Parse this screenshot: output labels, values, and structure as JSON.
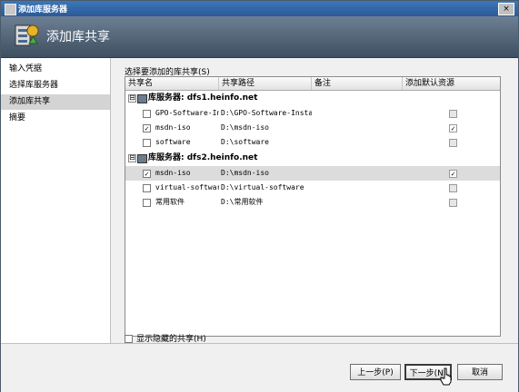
{
  "window": {
    "title": "添加库服务器",
    "close_glyph": "×"
  },
  "header": {
    "title": "添加库共享"
  },
  "nav": [
    {
      "label": "输入凭据",
      "selected": false
    },
    {
      "label": "选择库服务器",
      "selected": false
    },
    {
      "label": "添加库共享",
      "selected": true
    },
    {
      "label": "摘要",
      "selected": false
    }
  ],
  "content": {
    "section_label": "选择要添加的库共享(S)",
    "columns": [
      "共享名",
      "共享路径",
      "备注",
      "添加默认资源"
    ],
    "groups": [
      {
        "expander": "⊟",
        "label": "库服务器: dfs1.heinfo.net",
        "rows": [
          {
            "checked": false,
            "name": "GPO-Software-Ins",
            "path": "D:\\GPO-Software-Install",
            "default_checked": false
          },
          {
            "checked": true,
            "name": "msdn-iso",
            "path": "D:\\msdn-iso",
            "default_checked": true
          },
          {
            "checked": false,
            "name": "software",
            "path": "D:\\software",
            "default_checked": false
          }
        ]
      },
      {
        "expander": "⊟",
        "label": "库服务器: dfs2.heinfo.net",
        "rows": [
          {
            "checked": true,
            "name": "msdn-iso",
            "path": "D:\\msdn-iso",
            "default_checked": true,
            "highlighted": true
          },
          {
            "checked": false,
            "name": "virtual-software",
            "path": "D:\\virtual-software",
            "default_checked": false
          },
          {
            "checked": false,
            "name": "常用软件",
            "path": "D:\\常用软件",
            "default_checked": false
          }
        ]
      }
    ],
    "check_glyph": "✓",
    "show_hidden_label": "显示隐藏的共享(H)"
  },
  "buttons": {
    "back": "上一步(P)",
    "next": "下一步(N)",
    "cancel": "取消"
  },
  "colors": {
    "title_bar": "#2f66a8",
    "header_bg": "#55677a",
    "selected_nav": "#d4d4d4"
  }
}
